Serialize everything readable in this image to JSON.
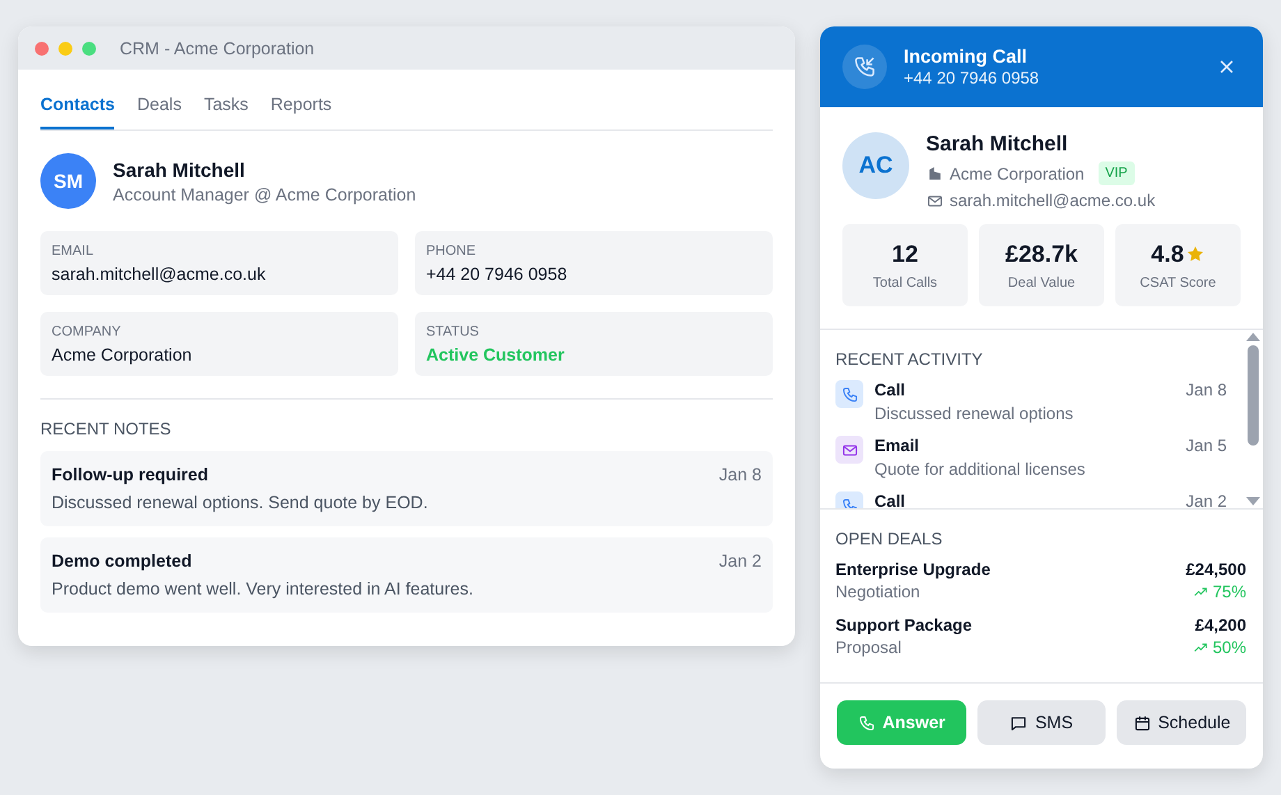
{
  "crm_window": {
    "title": "CRM - Acme Corporation",
    "tabs": [
      {
        "label": "Contacts",
        "selected": true
      },
      {
        "label": "Deals",
        "selected": false
      },
      {
        "label": "Tasks",
        "selected": false
      },
      {
        "label": "Reports",
        "selected": false
      }
    ],
    "contact": {
      "initials": "SM",
      "name": "Sarah Mitchell",
      "role": "Account Manager @ Acme Corporation"
    },
    "fields": [
      {
        "label": "EMAIL",
        "value": "sarah.mitchell@acme.co.uk",
        "kind": "text"
      },
      {
        "label": "PHONE",
        "value": "+44 20 7946 0958",
        "kind": "text"
      },
      {
        "label": "COMPANY",
        "value": "Acme Corporation",
        "kind": "text"
      },
      {
        "label": "STATUS",
        "value": "Active Customer",
        "kind": "status"
      }
    ],
    "notes_heading": "RECENT NOTES",
    "notes": [
      {
        "title": "Follow-up required",
        "date": "Jan 8",
        "text": "Discussed renewal options. Send quote by EOD."
      },
      {
        "title": "Demo completed",
        "date": "Jan 2",
        "text": "Product demo went well. Very interested in AI features."
      }
    ]
  },
  "call_panel": {
    "title": "Incoming Call",
    "number": "+44 20 7946 0958",
    "caller": {
      "initials": "AC",
      "name": "Sarah Mitchell",
      "company": "Acme Corporation",
      "badge": "VIP",
      "email": "sarah.mitchell@acme.co.uk"
    },
    "stats": [
      {
        "value": "12",
        "label": "Total Calls",
        "kind": "plain"
      },
      {
        "value": "£28.7k",
        "label": "Deal Value",
        "kind": "plain"
      },
      {
        "value": "4.8",
        "label": "CSAT Score",
        "kind": "rating"
      }
    ],
    "activity_heading": "RECENT ACTIVITY",
    "activity": [
      {
        "kind": "call",
        "title": "Call",
        "date": "Jan 8",
        "text": "Discussed renewal options"
      },
      {
        "kind": "email",
        "title": "Email",
        "date": "Jan 5",
        "text": "Quote for additional licenses"
      },
      {
        "kind": "call",
        "title": "Call",
        "date": "Jan 2"
      }
    ],
    "deals_heading": "OPEN DEALS",
    "deals": [
      {
        "name": "Enterprise Upgrade",
        "amount": "£24,500",
        "stage": "Negotiation",
        "probability": "75%"
      },
      {
        "name": "Support Package",
        "amount": "£4,200",
        "stage": "Proposal",
        "probability": "50%"
      }
    ],
    "buttons": [
      {
        "label": "Answer",
        "kind": "answer"
      },
      {
        "label": "SMS",
        "kind": "sms"
      },
      {
        "label": "Schedule",
        "kind": "schedule"
      }
    ]
  }
}
